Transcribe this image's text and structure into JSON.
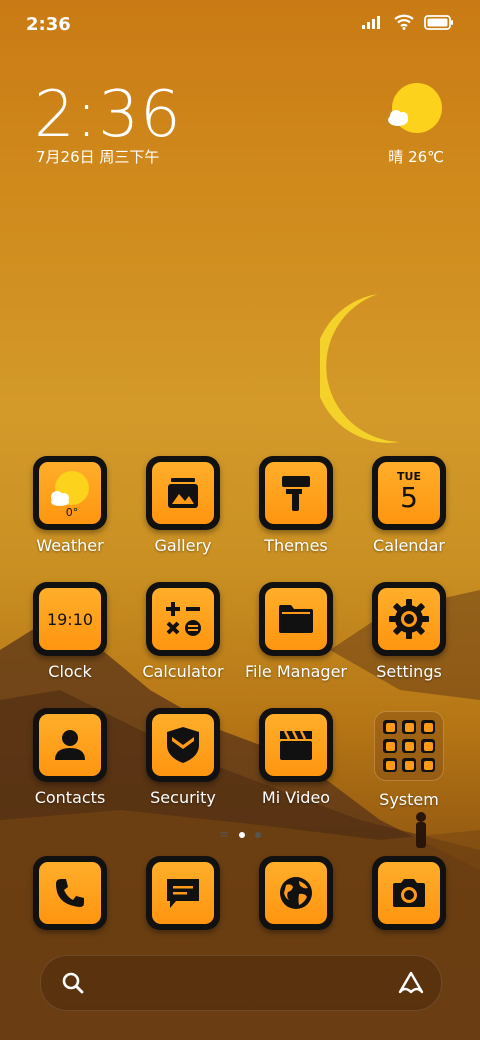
{
  "status_bar": {
    "time": "2:36"
  },
  "clock_widget": {
    "time": "2:36",
    "date": "7月26日 周三下午"
  },
  "weather_widget": {
    "condition_temp": "晴 26℃"
  },
  "apps": [
    {
      "name": "Weather",
      "icon": "weather-icon",
      "extra": "0°"
    },
    {
      "name": "Gallery",
      "icon": "gallery-icon"
    },
    {
      "name": "Themes",
      "icon": "paint-roller-icon"
    },
    {
      "name": "Calendar",
      "icon": "calendar-icon",
      "extra_day": "TUE",
      "extra_num": "5"
    },
    {
      "name": "Clock",
      "icon": "clock-icon",
      "extra": "19:10"
    },
    {
      "name": "Calculator",
      "icon": "calculator-icon"
    },
    {
      "name": "File Manager",
      "icon": "folder-icon"
    },
    {
      "name": "Settings",
      "icon": "gear-icon"
    },
    {
      "name": "Contacts",
      "icon": "contact-icon"
    },
    {
      "name": "Security",
      "icon": "shield-icon"
    },
    {
      "name": "Mi Video",
      "icon": "clapperboard-icon"
    },
    {
      "name": "System",
      "icon": "folder-grid-icon"
    }
  ],
  "dock": [
    {
      "icon": "phone-icon"
    },
    {
      "icon": "message-icon"
    },
    {
      "icon": "globe-icon"
    },
    {
      "icon": "camera-icon"
    }
  ],
  "colors": {
    "accent": "#ff9a18",
    "tile_dark": "#111111"
  }
}
